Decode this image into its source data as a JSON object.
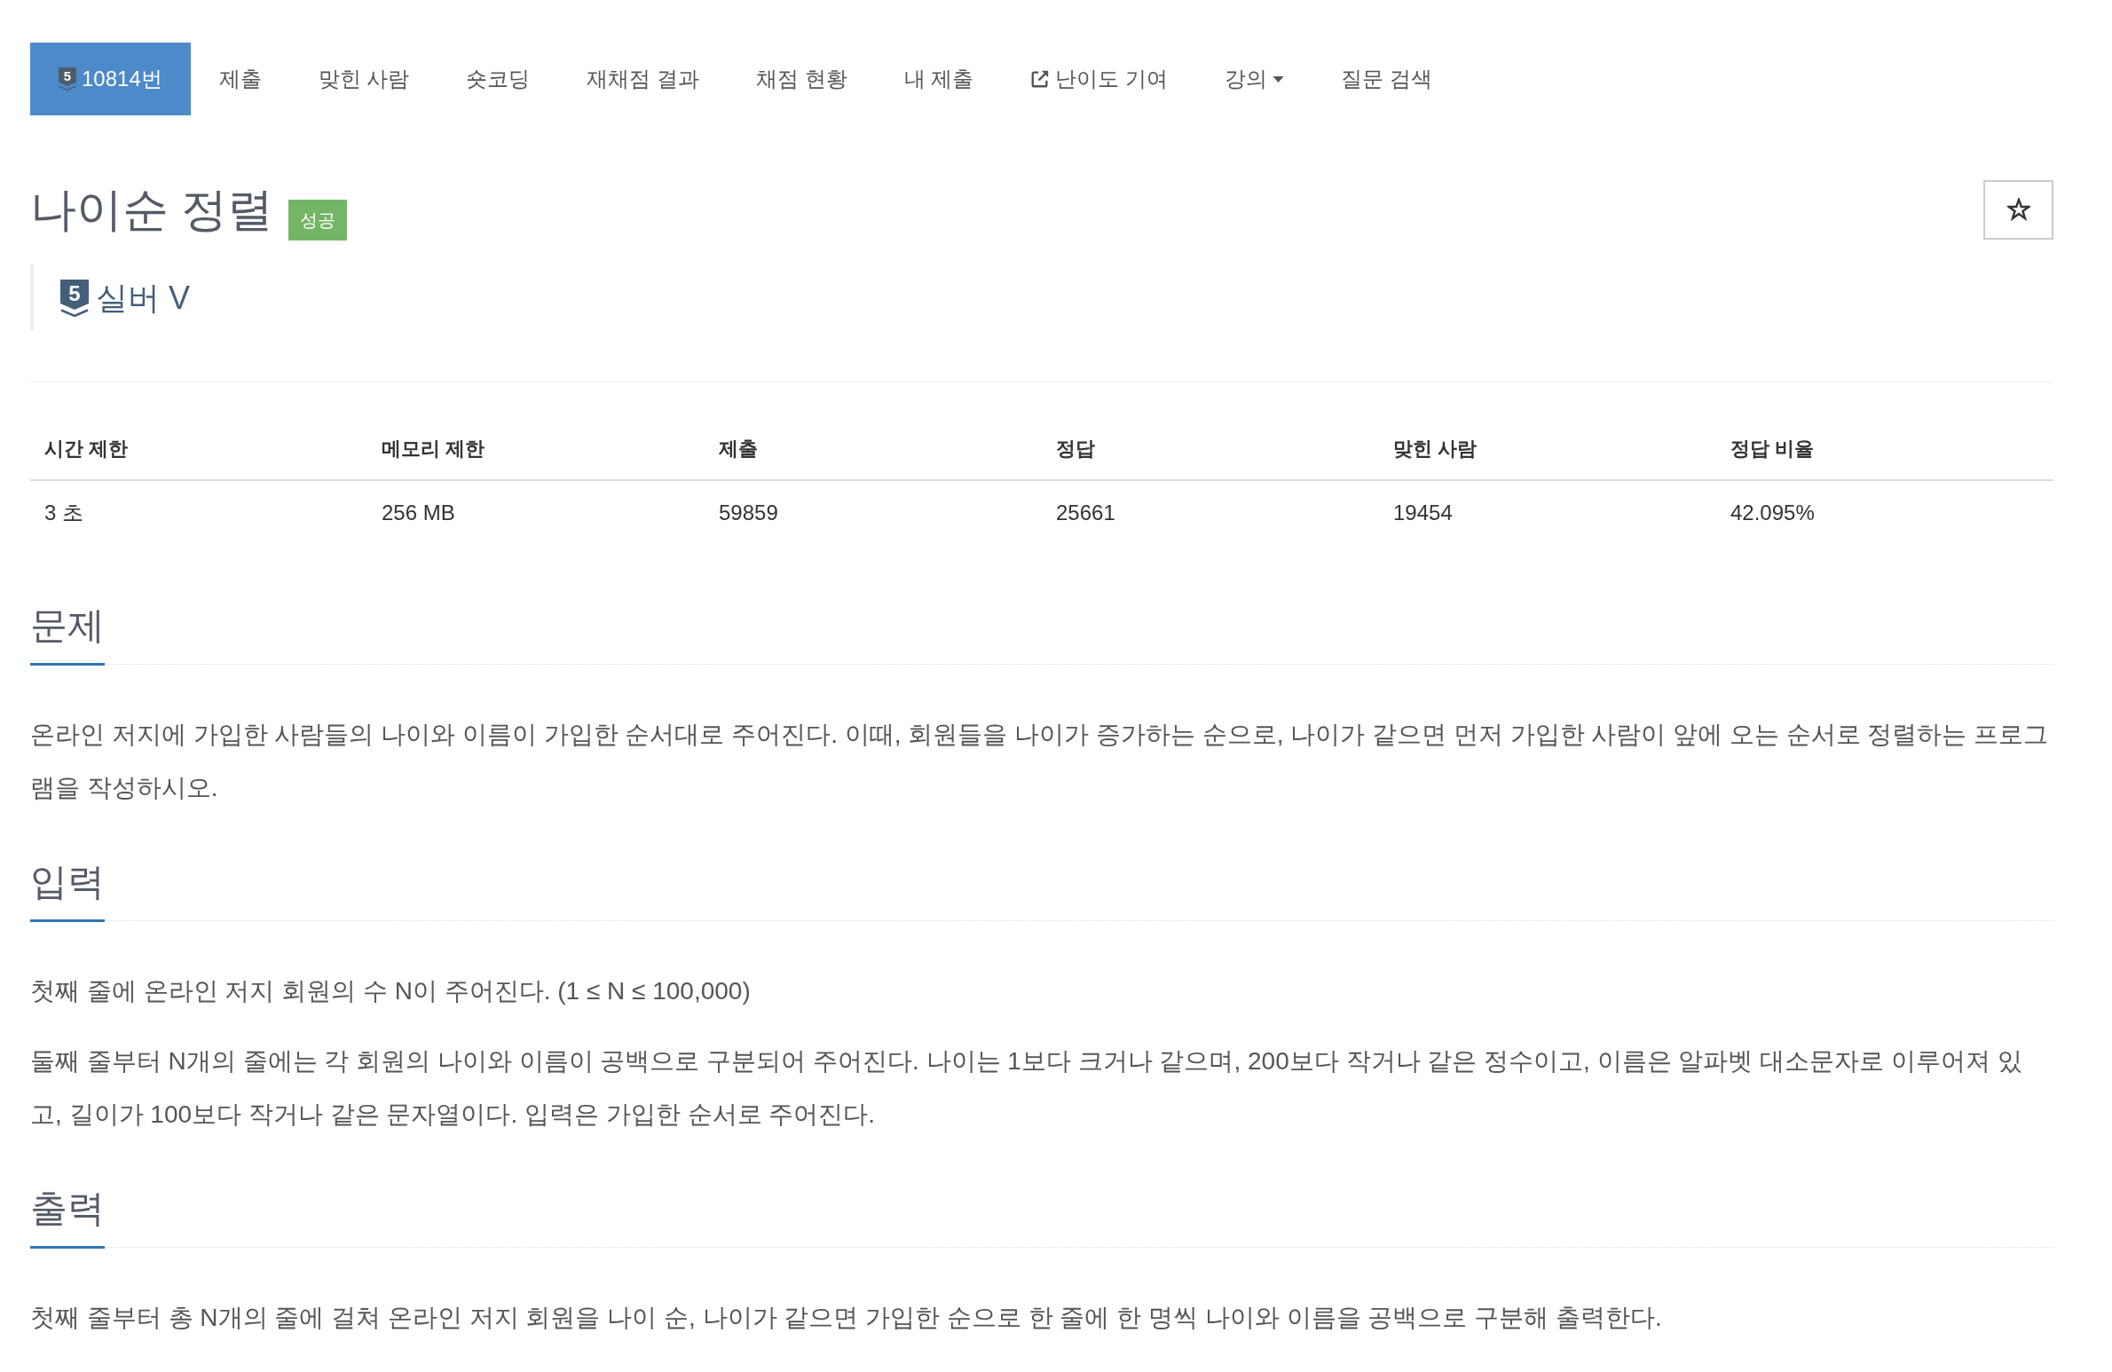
{
  "nav": {
    "items": [
      {
        "kind": "problem",
        "tier": "5",
        "label": "10814번",
        "selected": true
      },
      {
        "kind": "link",
        "label": "제출",
        "selected": false
      },
      {
        "kind": "link",
        "label": "맞힌 사람",
        "selected": false
      },
      {
        "kind": "link",
        "label": "숏코딩",
        "selected": false
      },
      {
        "kind": "link",
        "label": "재채점 결과",
        "selected": false
      },
      {
        "kind": "link",
        "label": "채점 현황",
        "selected": false
      },
      {
        "kind": "link",
        "label": "내 제출",
        "selected": false
      },
      {
        "kind": "external",
        "label": "난이도 기여",
        "selected": false
      },
      {
        "kind": "dropdown",
        "label": "강의",
        "selected": false
      },
      {
        "kind": "link",
        "label": "질문 검색",
        "selected": false
      }
    ]
  },
  "problem": {
    "title": "나이순 정렬",
    "result_badge": "성공",
    "starred": false,
    "tier": {
      "number": "5",
      "name": "실버 V"
    }
  },
  "stats_table": {
    "columns": [
      "시간 제한",
      "메모리 제한",
      "제출",
      "정답",
      "맞힌 사람",
      "정답 비율"
    ],
    "rows": [
      [
        "3 초",
        "256 MB",
        "59859",
        "25661",
        "19454",
        "42.095%"
      ]
    ]
  },
  "sections": [
    {
      "heading": "문제",
      "paragraphs": [
        "온라인 저지에 가입한 사람들의 나이와 이름이 가입한 순서대로 주어진다. 이때, 회원들을 나이가 증가하는 순으로, 나이가 같으면 먼저 가입한 사람이 앞에 오는 순서로 정렬하는 프로그램을 작성하시오."
      ]
    },
    {
      "heading": "입력",
      "paragraphs": [
        "첫째 줄에 온라인 저지 회원의 수 N이 주어진다. (1 ≤ N ≤ 100,000)",
        "둘째 줄부터 N개의 줄에는 각 회원의 나이와 이름이 공백으로 구분되어 주어진다. 나이는 1보다 크거나 같으며, 200보다 작거나 같은 정수이고, 이름은 알파벳 대소문자로 이루어져 있고, 길이가 100보다 작거나 같은 문자열이다. 입력은 가입한 순서로 주어진다."
      ]
    },
    {
      "heading": "출력",
      "paragraphs": [
        "첫째 줄부터 총 N개의 줄에 걸쳐 온라인 저지 회원을 나이 순, 나이가 같으면 가입한 순으로 한 줄에 한 명씩 나이와 이름을 공백으로 구분해 출력한다."
      ]
    }
  ]
}
